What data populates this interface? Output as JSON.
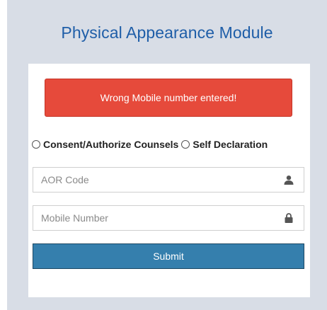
{
  "header": {
    "title": "Physical Appearance Module"
  },
  "alert": {
    "message": "Wrong Mobile number entered!",
    "color": "#e64a3b"
  },
  "radios": [
    {
      "label": "Consent/Authorize Counsels",
      "checked": false
    },
    {
      "label": "Self Declaration",
      "checked": false
    }
  ],
  "form": {
    "aor_placeholder": "AOR Code",
    "aor_value": "",
    "aor_icon": "user-icon",
    "mobile_placeholder": "Mobile Number",
    "mobile_value": "",
    "mobile_icon": "lock-icon",
    "submit_label": "Submit",
    "submit_color": "#357fad"
  }
}
